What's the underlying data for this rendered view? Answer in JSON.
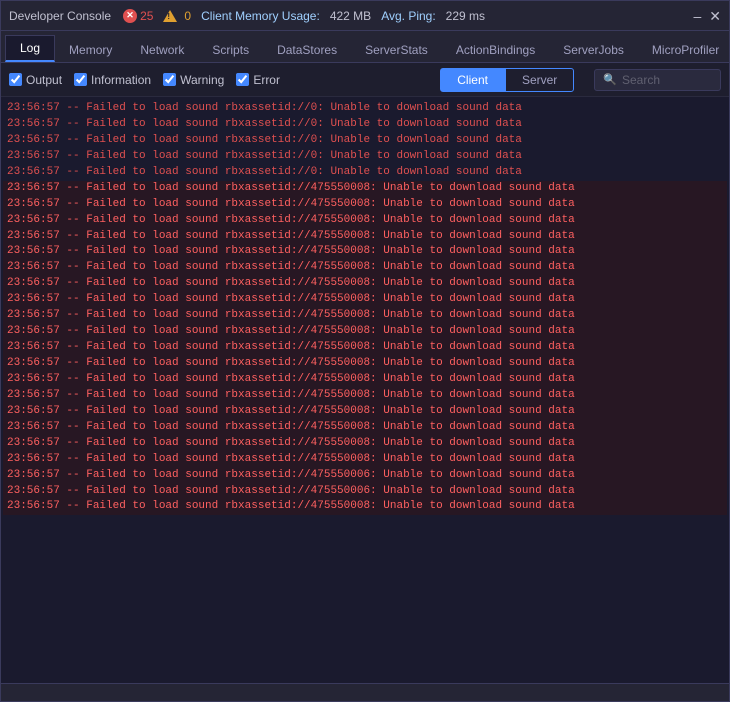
{
  "titleBar": {
    "title": "Developer Console",
    "errorCount": "25",
    "warningCount": "0",
    "memoryLabel": "Client Memory Usage:",
    "memoryValue": "422 MB",
    "pingLabel": "Avg. Ping:",
    "pingValue": "229 ms",
    "minimizeLabel": "–",
    "closeLabel": "✕"
  },
  "navTabs": {
    "tabs": [
      {
        "label": "Log",
        "active": true
      },
      {
        "label": "Memory",
        "active": false
      },
      {
        "label": "Network",
        "active": false
      },
      {
        "label": "Scripts",
        "active": false
      },
      {
        "label": "DataStores",
        "active": false
      },
      {
        "label": "ServerStats",
        "active": false
      },
      {
        "label": "ActionBindings",
        "active": false
      },
      {
        "label": "ServerJobs",
        "active": false
      },
      {
        "label": "MicroProfiler",
        "active": false
      }
    ]
  },
  "filterBar": {
    "outputLabel": "Output",
    "informationLabel": "Information",
    "warningLabel": "Warning",
    "errorLabel": "Error",
    "clientLabel": "Client",
    "serverLabel": "Server",
    "searchPlaceholder": "Search"
  },
  "logLines": [
    {
      "text": "23:56:57  --  Failed to load sound rbxassetid://0: Unable to download sound data",
      "type": "error"
    },
    {
      "text": "23:56:57  --  Failed to load sound rbxassetid://0: Unable to download sound data",
      "type": "error"
    },
    {
      "text": "23:56:57  --  Failed to load sound rbxassetid://0: Unable to download sound data",
      "type": "error"
    },
    {
      "text": "23:56:57  --  Failed to load sound rbxassetid://0: Unable to download sound data",
      "type": "error"
    },
    {
      "text": "23:56:57  --  Failed to load sound rbxassetid://0: Unable to download sound data",
      "type": "error"
    },
    {
      "text": "23:56:57  --  Failed to load sound rbxassetid://475550008: Unable to download sound data",
      "type": "error-highlight"
    },
    {
      "text": "23:56:57  --  Failed to load sound rbxassetid://475550008: Unable to download sound data",
      "type": "error-highlight"
    },
    {
      "text": "23:56:57  --  Failed to load sound rbxassetid://475550008: Unable to download sound data",
      "type": "error-highlight"
    },
    {
      "text": "23:56:57  --  Failed to load sound rbxassetid://475550008: Unable to download sound data",
      "type": "error-highlight"
    },
    {
      "text": "23:56:57  --  Failed to load sound rbxassetid://475550008: Unable to download sound data",
      "type": "error-highlight"
    },
    {
      "text": "23:56:57  --  Failed to load sound rbxassetid://475550008: Unable to download sound data",
      "type": "error-highlight"
    },
    {
      "text": "23:56:57  --  Failed to load sound rbxassetid://475550008: Unable to download sound data",
      "type": "error-highlight"
    },
    {
      "text": "23:56:57  --  Failed to load sound rbxassetid://475550008: Unable to download sound data",
      "type": "error-highlight"
    },
    {
      "text": "23:56:57  --  Failed to load sound rbxassetid://475550008: Unable to download sound data",
      "type": "error-highlight"
    },
    {
      "text": "23:56:57  --  Failed to load sound rbxassetid://475550008: Unable to download sound data",
      "type": "error-highlight"
    },
    {
      "text": "23:56:57  --  Failed to load sound rbxassetid://475550008: Unable to download sound data",
      "type": "error-highlight"
    },
    {
      "text": "23:56:57  --  Failed to load sound rbxassetid://475550008: Unable to download sound data",
      "type": "error-highlight"
    },
    {
      "text": "23:56:57  --  Failed to load sound rbxassetid://475550008: Unable to download sound data",
      "type": "error-highlight"
    },
    {
      "text": "23:56:57  --  Failed to load sound rbxassetid://475550008: Unable to download sound data",
      "type": "error-highlight"
    },
    {
      "text": "23:56:57  --  Failed to load sound rbxassetid://475550008: Unable to download sound data",
      "type": "error-highlight"
    },
    {
      "text": "23:56:57  --  Failed to load sound rbxassetid://475550008: Unable to download sound data",
      "type": "error-highlight"
    },
    {
      "text": "23:56:57  --  Failed to load sound rbxassetid://475550008: Unable to download sound data",
      "type": "error-highlight"
    },
    {
      "text": "23:56:57  --  Failed to load sound rbxassetid://475550008: Unable to download sound data",
      "type": "error-highlight"
    },
    {
      "text": "23:56:57  --  Failed to load sound rbxassetid://475550006: Unable to download sound data",
      "type": "error-highlight"
    },
    {
      "text": "23:56:57  --  Failed to load sound rbxassetid://475550006: Unable to download sound data",
      "type": "error-highlight"
    },
    {
      "text": "23:56:57  --  Failed to load sound rbxassetid://475550008: Unable to download sound data",
      "type": "error-highlight"
    }
  ],
  "colors": {
    "errorText": "#e05050",
    "errorHighlight": "#ff6060",
    "accent": "#4488ff"
  }
}
